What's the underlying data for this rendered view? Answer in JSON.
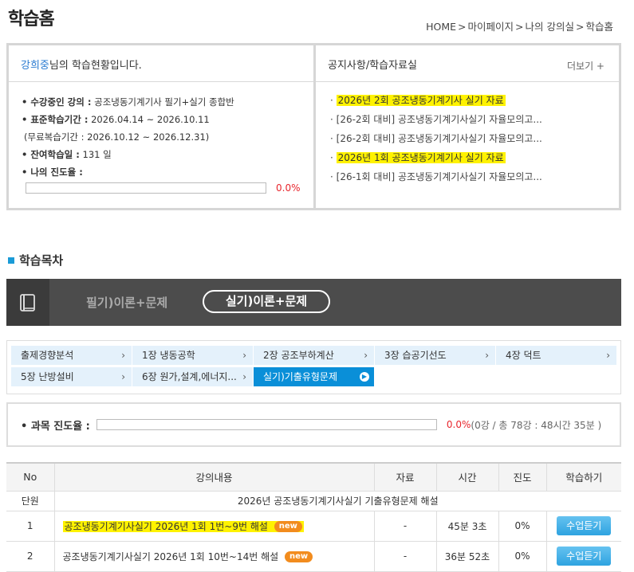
{
  "page": {
    "title": "학습홈"
  },
  "breadcrumb": [
    "HOME",
    "마이페이지",
    "나의 강의실",
    "학습홈"
  ],
  "breadcrumb_sep": ">",
  "status": {
    "user_name": "강희중",
    "header_suffix": "님의 학습현황입니다.",
    "course_label": "• 수강중인 강의 :",
    "course_value": " 공조냉동기계기사 필기+실기 종합반",
    "period_label": "• 표준학습기간 :",
    "period_value": " 2026.04.14 ~ 2026.10.11",
    "review_period": "(무료복습기간 : 2026.10.12 ~ 2026.12.31)",
    "remaining_label": "• 잔여학습일 :",
    "remaining_value": " 131 일",
    "progress_label": "• 나의 진도율 :",
    "progress_percent": 0,
    "progress_text": "0.0%"
  },
  "notices": {
    "title": "공지사항/학습자료실",
    "more": "더보기 +",
    "items": [
      {
        "text": "2026년 2회 공조냉동기계기사 실기 자료",
        "highlight": true
      },
      {
        "text": "[26-2회 대비] 공조냉동기계기사실기 자율모의고...",
        "highlight": false
      },
      {
        "text": "[26-2회 대비] 공조냉동기계기사실기 자율모의고...",
        "highlight": false
      },
      {
        "text": "2026년 1회 공조냉동기계기사 실기 자료",
        "highlight": true
      },
      {
        "text": "[26-1회 대비] 공조냉동기계기사실기 자율모의고...",
        "highlight": false
      }
    ]
  },
  "section": {
    "title": "학습목차"
  },
  "course_tabs": {
    "written": "필기)이론+문제",
    "practical": "실기)이론+문제"
  },
  "chapters": [
    "출제경향분석",
    "1장 냉동공학",
    "2장 공조부하계산",
    "3장 습공기선도",
    "4장 덕트",
    "5장 난방설비",
    "6장 원가,설계,에너지...",
    "실기)기출유형문제"
  ],
  "subject_progress": {
    "label": "• 과목 진도율 :",
    "percent": 0,
    "pct_text": "0.0%",
    "info": "(0강 / 총 78강 : 48시간 35분 )"
  },
  "table": {
    "headers": [
      "No",
      "강의내용",
      "자료",
      "시간",
      "진도",
      "학습하기"
    ],
    "unit_label": "단원",
    "unit_title": "2026년 공조냉동기계기사실기 기출유형문제 해설",
    "rows": [
      {
        "no": "1",
        "title": "공조냉동기계기사실기 2026년 1회 1번~9번 해설",
        "badge": "new",
        "material": "-",
        "time": "45분 3초",
        "progress": "0%",
        "button": "수업듣기",
        "highlight": true
      },
      {
        "no": "2",
        "title": "공조냉동기계기사실기 2026년 1회 10번~14번 해설",
        "badge": "new",
        "material": "-",
        "time": "36분 52초",
        "progress": "0%",
        "button": "수업듣기",
        "highlight": false
      }
    ]
  }
}
